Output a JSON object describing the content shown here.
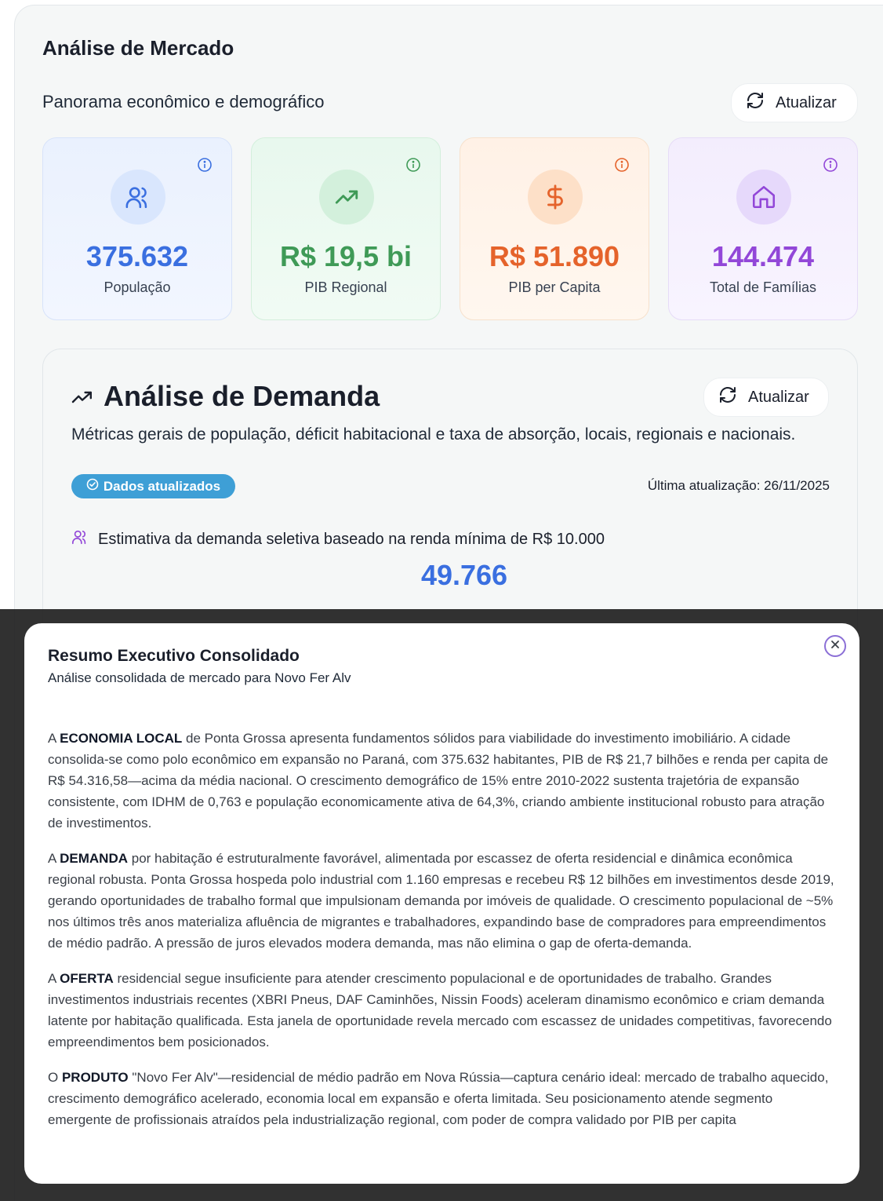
{
  "header": {
    "title": "Análise de Mercado",
    "subtitle": "Panorama econômico e demográfico",
    "refresh_label": "Atualizar"
  },
  "stats": [
    {
      "value": "375.632",
      "label": "População",
      "icon": "users-icon",
      "color": "#3a6fe0"
    },
    {
      "value": "R$ 19,5 bi",
      "label": "PIB Regional",
      "icon": "trending-up-icon",
      "color": "#3f9a57"
    },
    {
      "value": "R$ 51.890",
      "label": "PIB per Capita",
      "icon": "dollar-icon",
      "color": "#e5632b"
    },
    {
      "value": "144.474",
      "label": "Total de Famílias",
      "icon": "home-icon",
      "color": "#9247d8"
    }
  ],
  "demand": {
    "title": "Análise de Demanda",
    "description": "Métricas gerais de população, déficit habitacional e taxa de absorção, locais, regionais e nacionais.",
    "refresh_label": "Atualizar",
    "badge": "Dados atualizados",
    "last_update": "Última atualização: 26/11/2025",
    "estimate_label": "Estimativa da demanda seletiva baseado na renda mínima de R$ 10.000",
    "estimate_value": "49.766"
  },
  "modal": {
    "title": "Resumo Executivo Consolidado",
    "subtitle": "Análise consolidada de mercado para Novo Fer Alv",
    "paragraphs": [
      {
        "lead": "A ",
        "key": "ECONOMIA LOCAL",
        "text": " de Ponta Grossa apresenta fundamentos sólidos para viabilidade do investimento imobiliário. A cidade consolida-se como polo econômico em expansão no Paraná, com 375.632 habitantes, PIB de R$ 21,7 bilhões e renda per capita de R$ 54.316,58—acima da média nacional. O crescimento demográfico de 15% entre 2010-2022 sustenta trajetória de expansão consistente, com IDHM de 0,763 e população economicamente ativa de 64,3%, criando ambiente institucional robusto para atração de investimentos."
      },
      {
        "lead": "A ",
        "key": "DEMANDA",
        "text": " por habitação é estruturalmente favorável, alimentada por escassez de oferta residencial e dinâmica econômica regional robusta. Ponta Grossa hospeda polo industrial com 1.160 empresas e recebeu R$ 12 bilhões em investimentos desde 2019, gerando oportunidades de trabalho formal que impulsionam demanda por imóveis de qualidade. O crescimento populacional de ~5% nos últimos três anos materializa afluência de migrantes e trabalhadores, expandindo base de compradores para empreendimentos de médio padrão. A pressão de juros elevados modera demanda, mas não elimina o gap de oferta-demanda."
      },
      {
        "lead": "A ",
        "key": "OFERTA",
        "text": " residencial segue insuficiente para atender crescimento populacional e de oportunidades de trabalho. Grandes investimentos industriais recentes (XBRI Pneus, DAF Caminhões, Nissin Foods) aceleram dinamismo econômico e criam demanda latente por habitação qualificada. Esta janela de oportunidade revela mercado com escassez de unidades competitivas, favorecendo empreendimentos bem posicionados."
      },
      {
        "lead": "O ",
        "key": "PRODUTO",
        "text": " \"Novo Fer Alv\"—residencial de médio padrão em Nova Rússia—captura cenário ideal: mercado de trabalho aquecido, crescimento demográfico acelerado, economia local em expansão e oferta limitada. Seu posicionamento atende segmento emergente de profissionais atraídos pela industrialização regional, com poder de compra validado por PIB per capita"
      }
    ]
  },
  "colors": {
    "accent_blue": "#3a6fe0",
    "badge": "#3e9fd6",
    "overlay": "#202020"
  }
}
